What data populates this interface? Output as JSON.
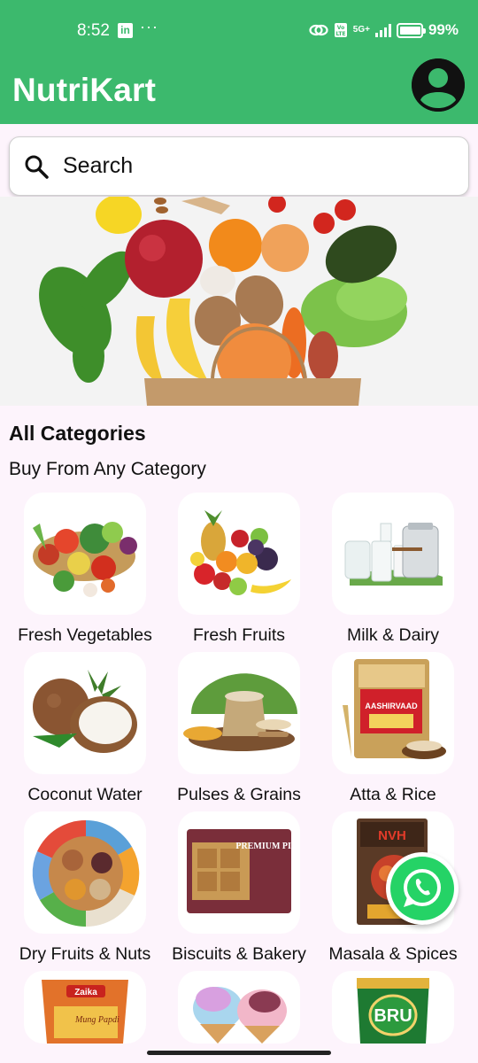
{
  "status_bar": {
    "time": "8:52",
    "linkedin_badge": "in",
    "more": "···",
    "network": "5G+",
    "battery": "99%"
  },
  "app": {
    "title": "NutriKart",
    "brand_color": "#3CB96D"
  },
  "search": {
    "placeholder": "Search"
  },
  "categories": {
    "title": "All Categories",
    "subtitle": "Buy From Any Category",
    "items": [
      {
        "label": "Fresh Vegetables"
      },
      {
        "label": "Fresh Fruits"
      },
      {
        "label": "Milk & Dairy"
      },
      {
        "label": "Coconut Water"
      },
      {
        "label": "Pulses & Grains"
      },
      {
        "label": "Atta & Rice"
      },
      {
        "label": "Dry Fruits & Nuts"
      },
      {
        "label": "Biscuits & Bakery"
      },
      {
        "label": "Masala & Spices"
      },
      {
        "label": ""
      },
      {
        "label": ""
      },
      {
        "label": ""
      }
    ]
  },
  "product_text": {
    "atta_brand": "AASHIRVAAD",
    "biscuit_brand": "PREMIUM PISTA",
    "masala_brand": "NVH",
    "snack_brand": "Zaika",
    "snack_name": "Mung Papdi",
    "coffee_brand": "BRU"
  },
  "icons": {
    "search": "search-icon",
    "avatar": "account-circle-icon",
    "whatsapp": "whatsapp-icon"
  }
}
